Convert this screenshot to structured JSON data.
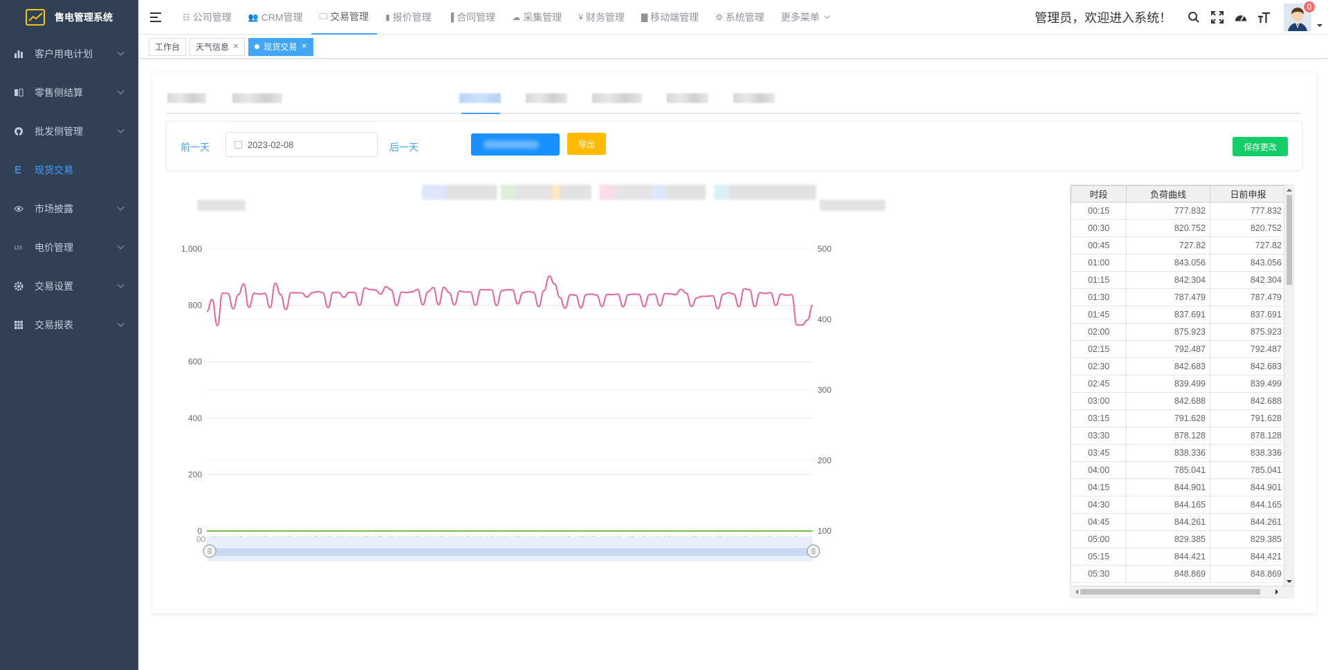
{
  "app": {
    "title": "售电管理系统"
  },
  "sidebar": {
    "items": [
      {
        "label": "客户用电计划",
        "icon": "bar-chart-icon",
        "active": false
      },
      {
        "label": "零售侧结算",
        "icon": "book-icon",
        "active": false
      },
      {
        "label": "批发侧管理",
        "icon": "github-icon",
        "active": false
      },
      {
        "label": "现货交易",
        "icon": "tree-icon",
        "active": true
      },
      {
        "label": "市场披露",
        "icon": "eye-icon",
        "active": false
      },
      {
        "label": "电价管理",
        "icon": "number-icon",
        "active": false
      },
      {
        "label": "交易设置",
        "icon": "gear-icon",
        "active": false
      },
      {
        "label": "交易报表",
        "icon": "table-icon",
        "active": false
      }
    ]
  },
  "topnav": {
    "items": [
      {
        "label": "公司管理",
        "icon": "list-icon"
      },
      {
        "label": "CRM管理",
        "icon": "people-icon"
      },
      {
        "label": "交易管理",
        "icon": "monitor-icon",
        "active": true
      },
      {
        "label": "报价管理",
        "icon": "bar-icon"
      },
      {
        "label": "合同管理",
        "icon": "door-icon"
      },
      {
        "label": "采集管理",
        "icon": "cloud-icon"
      },
      {
        "label": "财务管理",
        "icon": "yen-icon"
      },
      {
        "label": "移动端管理",
        "icon": "clipboard-icon"
      },
      {
        "label": "系统管理",
        "icon": "gear-icon"
      },
      {
        "label": "更多菜单",
        "icon": "chevron-down-icon"
      }
    ],
    "welcome": "管理员，欢迎进入系统！",
    "badge_count": "0"
  },
  "tags": [
    {
      "label": "工作台",
      "active": false,
      "closable": false
    },
    {
      "label": "天气信息",
      "active": false,
      "closable": true
    },
    {
      "label": "现货交易",
      "active": true,
      "closable": true
    }
  ],
  "toolbar": {
    "prev_day": "前一天",
    "date": "2023-02-08",
    "next_day": "后一天",
    "export": "导出",
    "save": "保存更改"
  },
  "colors": {
    "sidebar_bg": "#304156",
    "accent": "#409eff",
    "line": "#e8619e",
    "export_btn": "#ffba00",
    "save_btn": "#13ce66"
  },
  "chart_data": {
    "type": "line",
    "x": [
      "00:15",
      "00:30",
      "00:45",
      "01:00",
      "01:15",
      "01:30",
      "01:45",
      "02:00",
      "02:15",
      "02:30",
      "02:45",
      "03:00",
      "03:15",
      "03:30",
      "03:45",
      "04:00",
      "04:15",
      "04:30",
      "04:45",
      "05:00",
      "05:15",
      "05:30",
      "05:45",
      "06:00",
      "06:15",
      "06:30",
      "06:45",
      "07:00",
      "07:15",
      "07:30",
      "07:45",
      "08:00",
      "08:15",
      "08:30",
      "08:45",
      "09:00",
      "09:15",
      "09:30",
      "09:45",
      "10:00",
      "10:15",
      "10:30",
      "10:45",
      "11:00",
      "11:15",
      "11:30",
      "11:45",
      "12:00",
      "12:15",
      "12:30",
      "12:45",
      "13:00",
      "13:15",
      "13:30",
      "13:45",
      "14:00",
      "14:15",
      "14:30",
      "14:45",
      "15:00",
      "15:15",
      "15:30",
      "15:45",
      "16:00",
      "16:15",
      "16:30",
      "16:45",
      "17:00",
      "17:15",
      "17:30",
      "17:45",
      "18:00",
      "18:15",
      "18:30",
      "18:45",
      "19:00",
      "19:15",
      "19:30",
      "19:45",
      "20:00",
      "20:15",
      "20:30",
      "20:45",
      "21:00",
      "21:15",
      "21:30",
      "21:45",
      "22:00",
      "22:15",
      "22:30",
      "22:45",
      "23:00",
      "23:15",
      "23:30",
      "23:45",
      "24:00"
    ],
    "xtick_labels": [
      "00:15",
      "01:15",
      "02:15",
      "03:15",
      "04:15",
      "05:15",
      "06:15",
      "07:15",
      "08:15",
      "09:15",
      "10:15",
      "11:15",
      "12:15",
      "13:15",
      "14:15",
      "15:15",
      "16:15",
      "17:15",
      "18:15",
      "19:15",
      "20:15",
      "21:15",
      "22:15",
      "23:15"
    ],
    "series": [
      {
        "axis": "left",
        "color": "#e8619e",
        "values": [
          777.832,
          820.752,
          727.82,
          843.056,
          842.304,
          787.479,
          837.691,
          875.923,
          792.487,
          842.683,
          839.499,
          842.688,
          791.628,
          878.128,
          838.336,
          785.041,
          844.901,
          844.165,
          844.261,
          829.385,
          844.421,
          848.869,
          845,
          792,
          846,
          846,
          828,
          846,
          846,
          800,
          862,
          856,
          854,
          840,
          866,
          855,
          799,
          847,
          845,
          848,
          856,
          802,
          849,
          863,
          802,
          864,
          845,
          802,
          851,
          847,
          848,
          800,
          856,
          855,
          855,
          799,
          852,
          855,
          855,
          805,
          845,
          849,
          846,
          795,
          852,
          904,
          876,
          828,
          790,
          838,
          836,
          791,
          838,
          840,
          836,
          796,
          839,
          838,
          840,
          795,
          838,
          840,
          839,
          795,
          838,
          840,
          798,
          842,
          840,
          838,
          857,
          843,
          796,
          826,
          832,
          832,
          834,
          788,
          839,
          845,
          840,
          795,
          859,
          855,
          795,
          845,
          842,
          845,
          800,
          840,
          836,
          838,
          730,
          730,
          748,
          800
        ]
      },
      {
        "axis": "left",
        "color": "#7ac143",
        "values": [
          0
        ]
      }
    ],
    "ylim_left": [
      0,
      1000
    ],
    "yticks_left": [
      "0",
      "200",
      "400",
      "600",
      "800",
      "1,000"
    ],
    "ylim_right": [
      100,
      500
    ],
    "yticks_right": [
      "100",
      "200",
      "300",
      "400",
      "500"
    ]
  },
  "table": {
    "columns": [
      "时段",
      "负荷曲线",
      "日前申报"
    ],
    "rows": [
      [
        "00:15",
        "777.832",
        "777.832"
      ],
      [
        "00:30",
        "820.752",
        "820.752"
      ],
      [
        "00:45",
        "727.82",
        "727.82"
      ],
      [
        "01:00",
        "843.056",
        "843.056"
      ],
      [
        "01:15",
        "842.304",
        "842.304"
      ],
      [
        "01:30",
        "787.479",
        "787.479"
      ],
      [
        "01:45",
        "837.691",
        "837.691"
      ],
      [
        "02:00",
        "875.923",
        "875.923"
      ],
      [
        "02:15",
        "792.487",
        "792.487"
      ],
      [
        "02:30",
        "842.683",
        "842.683"
      ],
      [
        "02:45",
        "839.499",
        "839.499"
      ],
      [
        "03:00",
        "842.688",
        "842.688"
      ],
      [
        "03:15",
        "791.628",
        "791.628"
      ],
      [
        "03:30",
        "878.128",
        "878.128"
      ],
      [
        "03:45",
        "838.336",
        "838.336"
      ],
      [
        "04:00",
        "785.041",
        "785.041"
      ],
      [
        "04:15",
        "844.901",
        "844.901"
      ],
      [
        "04:30",
        "844.165",
        "844.165"
      ],
      [
        "04:45",
        "844.261",
        "844.261"
      ],
      [
        "05:00",
        "829.385",
        "829.385"
      ],
      [
        "05:15",
        "844.421",
        "844.421"
      ],
      [
        "05:30",
        "848.869",
        "848.869"
      ]
    ]
  }
}
